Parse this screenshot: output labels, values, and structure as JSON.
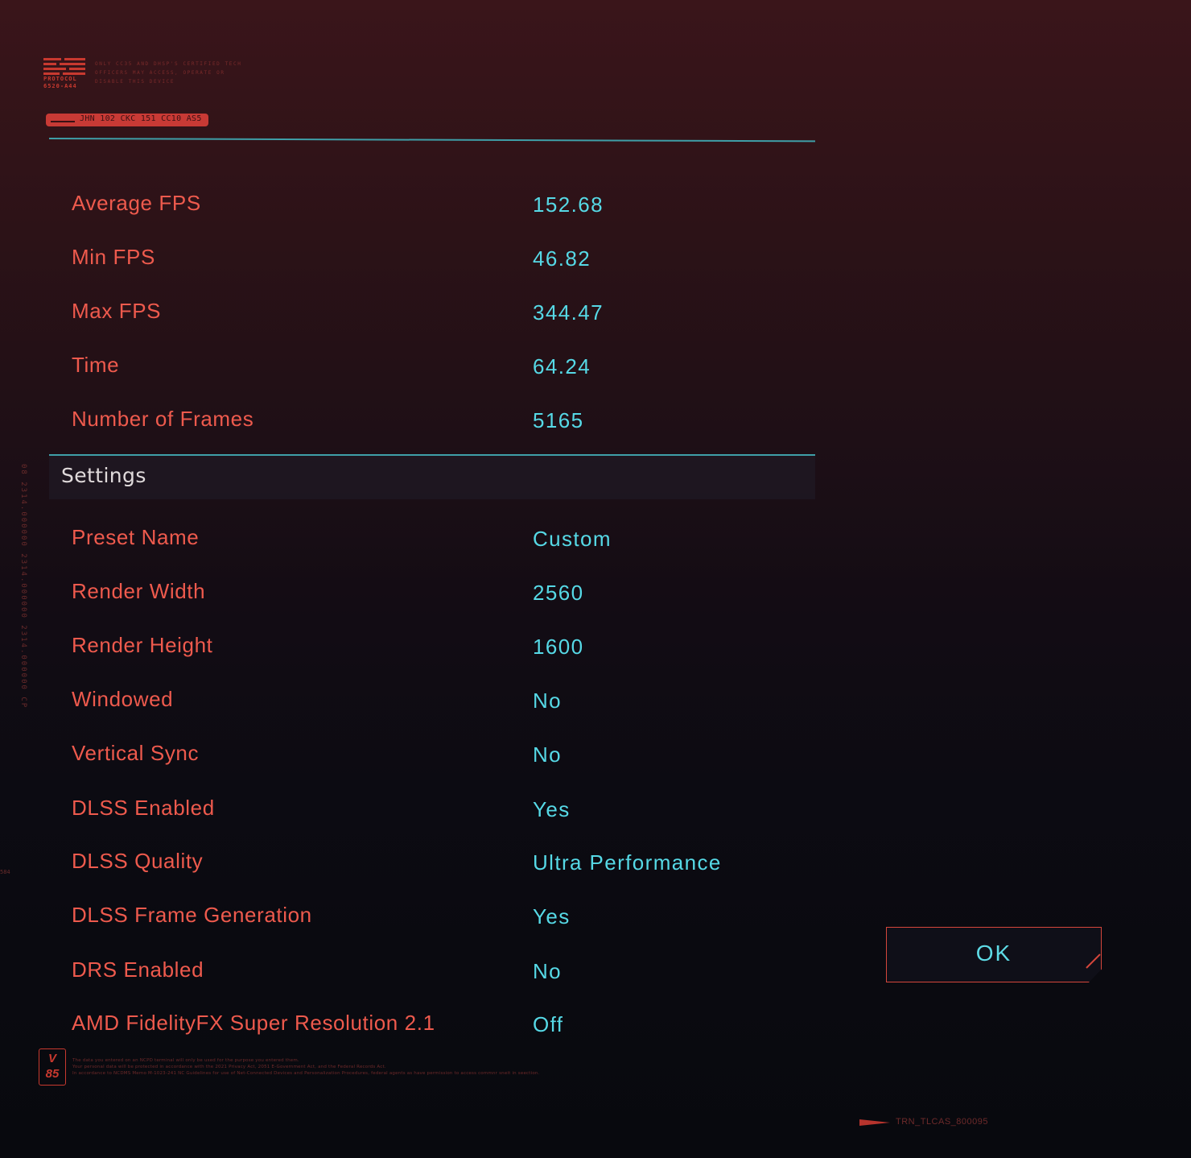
{
  "header": {
    "protocol_label": "PROTOCOL",
    "protocol_code": "6520-A44",
    "notice_lines": [
      "ONLY CC35 AND DHSP'S CERTIFIED TECH",
      "OFFICERS MAY ACCESS, OPERATE OR",
      "DISABLE THIS DEVICE"
    ],
    "serial": "JHN 102 CKC 151 CC10 AS5"
  },
  "results": [
    {
      "label": "Average FPS",
      "value": "152.68"
    },
    {
      "label": "Min FPS",
      "value": "46.82"
    },
    {
      "label": "Max FPS",
      "value": "344.47"
    },
    {
      "label": "Time",
      "value": "64.24"
    },
    {
      "label": "Number of Frames",
      "value": "5165"
    }
  ],
  "settings": {
    "title": "Settings",
    "items": [
      {
        "label": "Preset Name",
        "value": "Custom"
      },
      {
        "label": "Render Width",
        "value": "2560"
      },
      {
        "label": "Render Height",
        "value": "1600"
      },
      {
        "label": "Windowed",
        "value": "No"
      },
      {
        "label": "Vertical Sync",
        "value": "No"
      },
      {
        "label": "DLSS Enabled",
        "value": "Yes"
      },
      {
        "label": "DLSS Quality",
        "value": "Ultra Performance"
      },
      {
        "label": "DLSS Frame Generation",
        "value": "Yes"
      },
      {
        "label": "DRS Enabled",
        "value": "No"
      },
      {
        "label": "AMD FidelityFX Super Resolution 2.1",
        "value": "Off"
      }
    ]
  },
  "ok_button": {
    "label": "OK"
  },
  "side": {
    "vertical_code": "08 2314.000000 2314.000000 2314.000000 CP",
    "small_mark": "584"
  },
  "footer": {
    "badge_top": "V",
    "badge_bottom": "85",
    "disclaimer_lines": [
      "The data you entered on an NCPD terminal will only be used for the purpose you entered them.",
      "Your personal data will be protected in accordance with the 2021 Privacy Act, 2051 E-Government Act, and the Federal Records Act.",
      "In accordance to NCDMS Memo M-1023-241 NC Guidelines for use of Net-Connected Devices and Personalization Procedures, federal agents as have permission to access commnr sneit in seection."
    ],
    "code": "TRN_TLCAS_800095"
  },
  "colors": {
    "label": "#ee5a4d",
    "value": "#56d9e6",
    "divider": "#3f9fa8",
    "accent_red": "#c8392f"
  }
}
